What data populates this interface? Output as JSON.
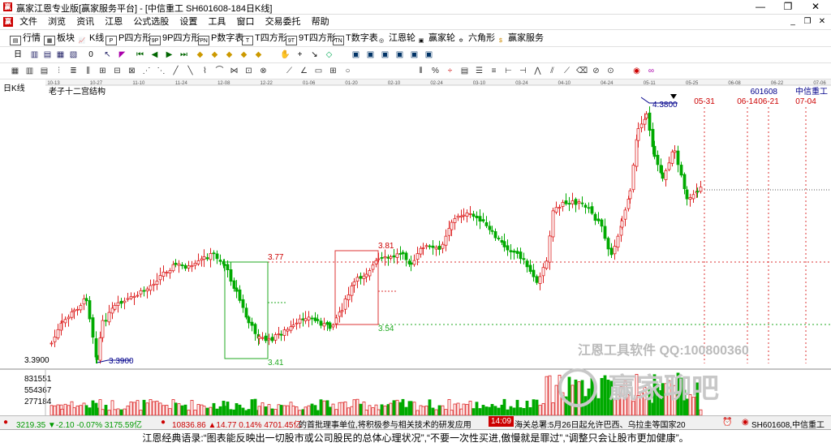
{
  "window": {
    "title": "赢家江恩专业版[赢家服务平台] - [中信重工  SH601608-184日K线]",
    "app_icon": "赢",
    "btn_minimize": "—",
    "btn_restore": "❐",
    "btn_close": "✕"
  },
  "menu": {
    "items": [
      "文件",
      "浏览",
      "资讯",
      "江恩",
      "公式选股",
      "设置",
      "工具",
      "窗口",
      "交易委托",
      "帮助"
    ],
    "mdi_min": "_",
    "mdi_restore": "❐",
    "mdi_close": "✕"
  },
  "toolbar1": {
    "items": [
      {
        "icon": "▤",
        "label": "行情"
      },
      {
        "icon": "▦",
        "label": "板块"
      },
      {
        "icon": "📈",
        "label": "K线"
      },
      {
        "icon": "P",
        "label": "P四方形"
      },
      {
        "icon": "9P",
        "label": "9P四方形"
      },
      {
        "icon": "PN",
        "label": "P数字表"
      },
      {
        "icon": "T",
        "label": "T四方形"
      },
      {
        "icon": "9T",
        "label": "9T四方形"
      },
      {
        "icon": "TN",
        "label": "T数字表"
      },
      {
        "icon": "◎",
        "label": "江恩轮"
      },
      {
        "icon": "▣",
        "label": "赢家轮"
      },
      {
        "icon": "✡",
        "label": "六角形"
      },
      {
        "icon": "$",
        "label": "赢家服务"
      }
    ]
  },
  "toolbar2": {
    "period_label": "日",
    "num_label": "0"
  },
  "chart": {
    "panel_label": "日K线",
    "study_title": "老子十二宫结构",
    "stock_code": "601608",
    "stock_name": "中信重工",
    "top_dates": [
      "10-13",
      "10-27",
      "11-10",
      "11-24",
      "12-08",
      "12-22",
      "01-06",
      "01-20",
      "02-10",
      "02-24",
      "03-10",
      "03-24",
      "04-10",
      "04-24",
      "05-11",
      "05-25",
      "06-08",
      "06-22",
      "07-06"
    ],
    "right_dates": [
      "05-31",
      "06-14",
      "06-21",
      "07-04"
    ],
    "high_label": "4.3800",
    "low_label": "3.3900",
    "left_price_label": "3.3900",
    "box1_top": "3.77",
    "box1_bottom": "3.41",
    "box2_top": "3.81",
    "box2_bottom": "3.54",
    "volume_labels": [
      "831551",
      "554367",
      "277184"
    ],
    "watermark1": "江恩工具软件   QQ:100800360",
    "watermark2": "赢家聊吧"
  },
  "chart_data": {
    "type": "candlestick",
    "title": "老子十二宫结构",
    "symbol": "601608 中信重工",
    "period": "日K线",
    "price_marks": {
      "high": 4.38,
      "low": 3.39,
      "box1": [
        3.41,
        3.77
      ],
      "box2": [
        3.54,
        3.81
      ]
    },
    "volume_axis_ticks": [
      277184,
      554367,
      831551
    ],
    "x_axis_dates": [
      "10-13",
      "10-27",
      "11-10",
      "11-24",
      "12-08",
      "12-22",
      "01-06",
      "01-20",
      "02-10",
      "02-24",
      "03-10",
      "03-24",
      "04-10",
      "04-24",
      "05-11",
      "05-25",
      "06-08",
      "06-22",
      "07-06"
    ]
  },
  "status": {
    "sh_index": "3219.35 ▼-2.10 -0.07% 3175.59亿",
    "sz_index": "10836.86 ▲14.77 0.14% 4701.45亿",
    "news1": "的首批理事单位,将积极参与相关技术的研发应用",
    "news_time": "14:09",
    "news2": "海关总署:5月26日起允许巴西、乌拉圭等国家20",
    "stock_tag": "SH601608,中信重工"
  },
  "footer": {
    "quote": "江恩经典语录:“图表能反映出一切股市或公司股民的总体心理状况”,“不要一次性买进,傲慢就是罪过”,“调整只会让股市更加健康”。"
  }
}
